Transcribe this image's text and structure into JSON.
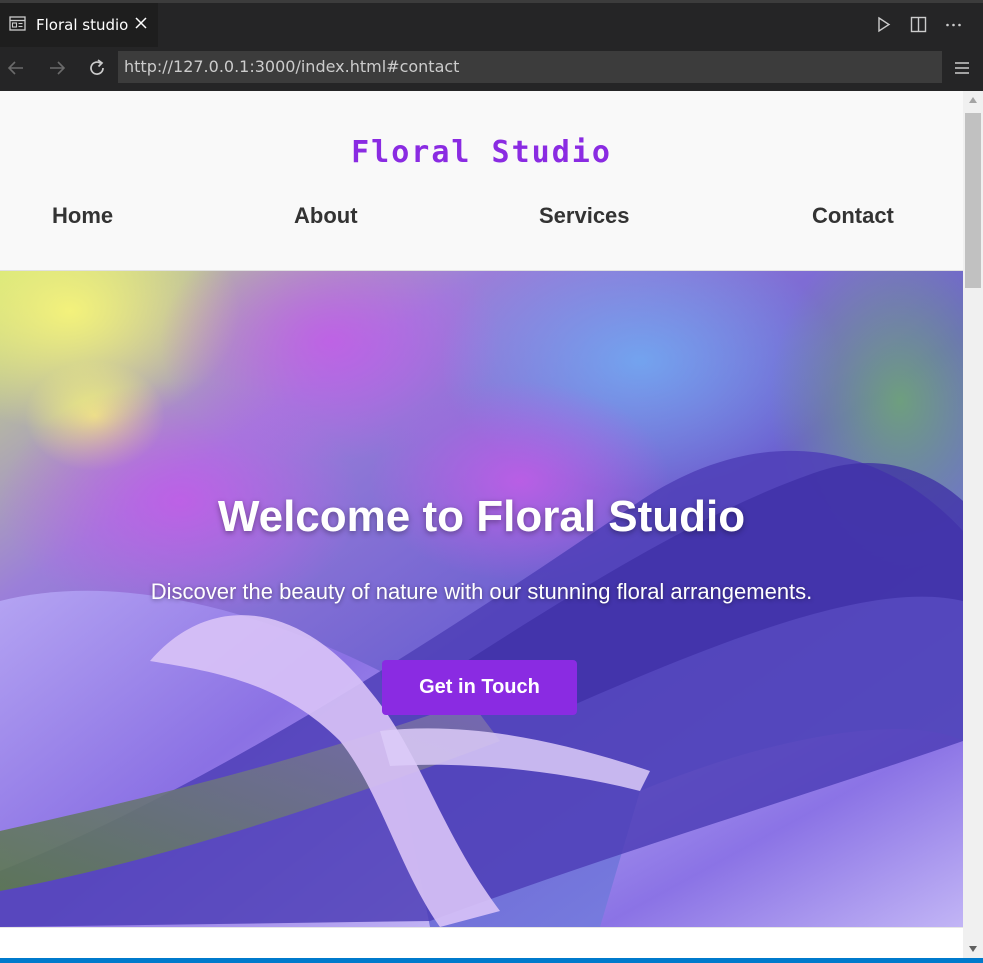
{
  "editor": {
    "tab_title": "Floral studio",
    "tab_icon": "browser-preview-icon",
    "actions": [
      "run-icon",
      "split-editor-icon",
      "more-actions-icon"
    ]
  },
  "browser": {
    "url": "http://127.0.0.1:3000/index.html#contact",
    "buttons": [
      "back-arrow-icon",
      "forward-arrow-icon",
      "reload-icon",
      "menu-icon"
    ]
  },
  "site": {
    "logo": "Floral Studio",
    "nav": {
      "home": "Home",
      "about": "About",
      "services": "Services",
      "contact": "Contact"
    },
    "hero": {
      "title": "Welcome to Floral Studio",
      "subtitle": "Discover the beauty of nature with our stunning floral arrangements.",
      "cta": "Get in Touch"
    }
  },
  "colors": {
    "accent": "#8a2be2",
    "nav_text": "#333333",
    "header_bg": "#f9f9f9",
    "editor_bg": "#1e1e1e",
    "status_bar": "#007acc"
  }
}
